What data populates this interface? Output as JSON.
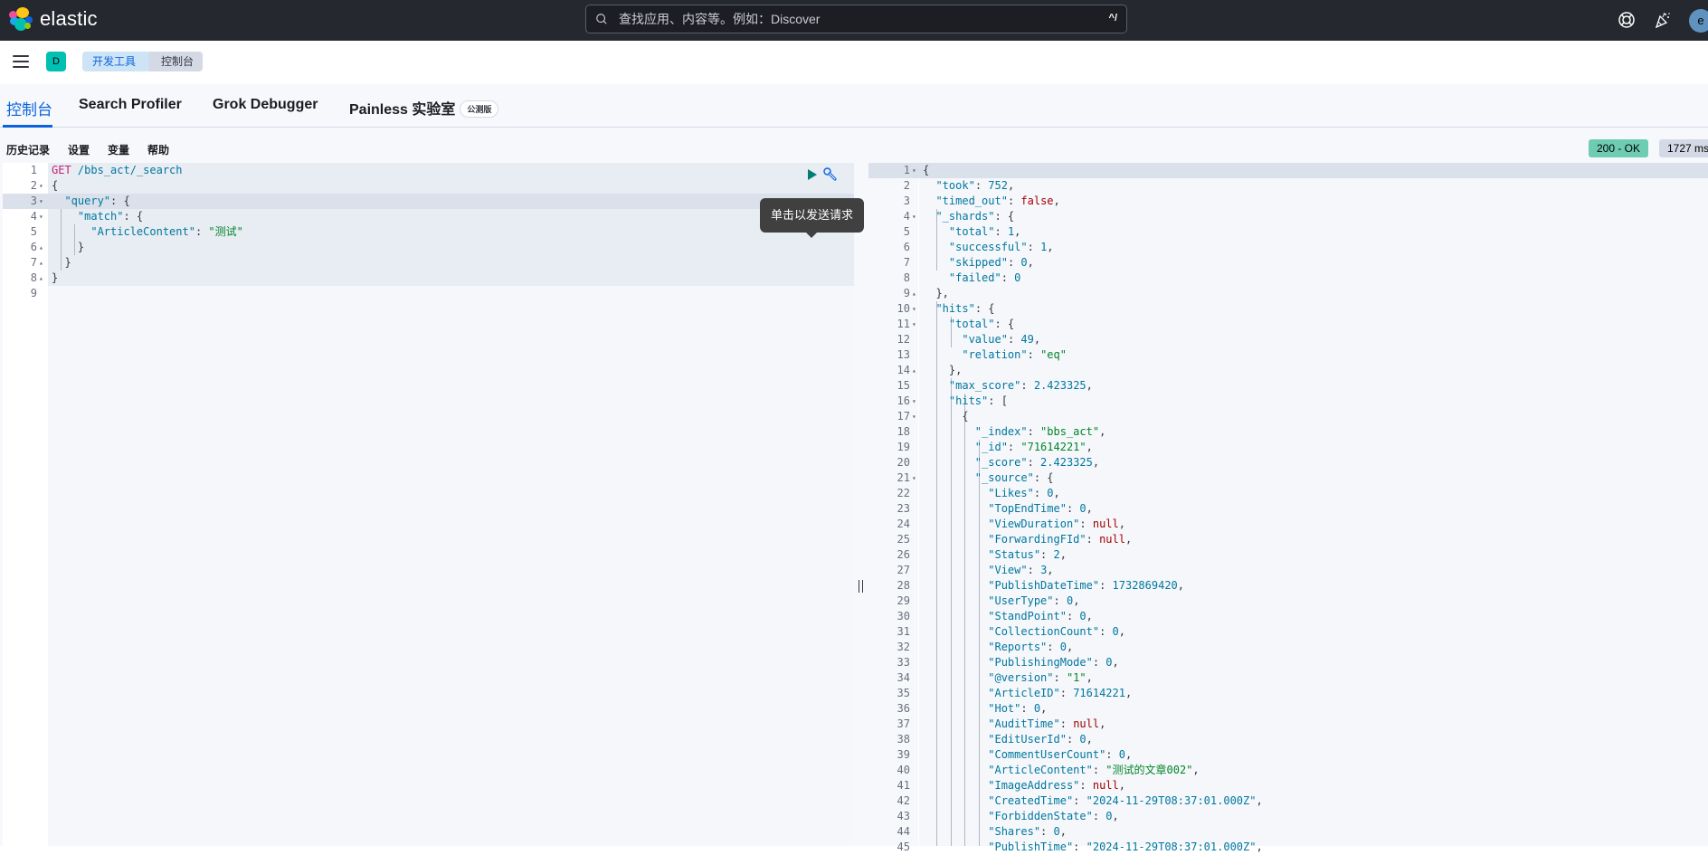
{
  "header": {
    "brand": "elastic",
    "search_placeholder": "查找应用、内容等。例如：Discover",
    "search_shortcut": "^/",
    "avatar_letter": "e"
  },
  "breadcrumbs": {
    "space_letter": "D",
    "items": [
      "开发工具",
      "控制台"
    ]
  },
  "tabs": [
    {
      "label": "控制台",
      "active": true
    },
    {
      "label": "Search Profiler",
      "active": false
    },
    {
      "label": "Grok Debugger",
      "active": false
    },
    {
      "label": "Painless 实验室",
      "active": false,
      "badge": "公测版"
    }
  ],
  "toolbar": [
    "历史记录",
    "设置",
    "变量",
    "帮助"
  ],
  "tooltip": "单击以发送请求",
  "response_status": {
    "status": "200 - OK",
    "status_color": "#6dccb1",
    "time": "1727 ms"
  },
  "request_editor": {
    "lines": [
      {
        "n": "1",
        "fold": "",
        "tokens": [
          [
            "m",
            "GET "
          ],
          [
            "k",
            "/bbs_act/_search"
          ]
        ]
      },
      {
        "n": "2",
        "fold": "▾",
        "tokens": [
          [
            "p",
            "{"
          ]
        ]
      },
      {
        "n": "3",
        "fold": "▾",
        "tokens": [
          [
            "p",
            "  "
          ],
          [
            "k",
            "\"query\""
          ],
          [
            "p",
            ": {"
          ]
        ]
      },
      {
        "n": "4",
        "fold": "▾",
        "tokens": [
          [
            "p",
            "    "
          ],
          [
            "k",
            "\"match\""
          ],
          [
            "p",
            ": {"
          ]
        ]
      },
      {
        "n": "5",
        "fold": "",
        "tokens": [
          [
            "p",
            "      "
          ],
          [
            "k",
            "\"ArticleContent\""
          ],
          [
            "p",
            ": "
          ],
          [
            "s",
            "\"测试\""
          ]
        ]
      },
      {
        "n": "6",
        "fold": "▴",
        "tokens": [
          [
            "p",
            "    }"
          ]
        ]
      },
      {
        "n": "7",
        "fold": "▴",
        "tokens": [
          [
            "p",
            "  }"
          ]
        ]
      },
      {
        "n": "8",
        "fold": "▴",
        "tokens": [
          [
            "p",
            "}"
          ]
        ]
      },
      {
        "n": "9",
        "fold": "",
        "tokens": []
      }
    ]
  },
  "response_editor": {
    "lines": [
      {
        "n": "1",
        "fold": "▾",
        "tokens": [
          [
            "p",
            "{"
          ]
        ]
      },
      {
        "n": "2",
        "fold": "",
        "tokens": [
          [
            "p",
            "  "
          ],
          [
            "k",
            "\"took\""
          ],
          [
            "p",
            ": "
          ],
          [
            "n",
            "752"
          ],
          [
            "p",
            ","
          ]
        ]
      },
      {
        "n": "3",
        "fold": "",
        "tokens": [
          [
            "p",
            "  "
          ],
          [
            "k",
            "\"timed_out\""
          ],
          [
            "p",
            ": "
          ],
          [
            "b",
            "false"
          ],
          [
            "p",
            ","
          ]
        ]
      },
      {
        "n": "4",
        "fold": "▾",
        "tokens": [
          [
            "p",
            "  "
          ],
          [
            "k",
            "\"_shards\""
          ],
          [
            "p",
            ": {"
          ]
        ]
      },
      {
        "n": "5",
        "fold": "",
        "tokens": [
          [
            "p",
            "    "
          ],
          [
            "k",
            "\"total\""
          ],
          [
            "p",
            ": "
          ],
          [
            "n",
            "1"
          ],
          [
            "p",
            ","
          ]
        ]
      },
      {
        "n": "6",
        "fold": "",
        "tokens": [
          [
            "p",
            "    "
          ],
          [
            "k",
            "\"successful\""
          ],
          [
            "p",
            ": "
          ],
          [
            "n",
            "1"
          ],
          [
            "p",
            ","
          ]
        ]
      },
      {
        "n": "7",
        "fold": "",
        "tokens": [
          [
            "p",
            "    "
          ],
          [
            "k",
            "\"skipped\""
          ],
          [
            "p",
            ": "
          ],
          [
            "n",
            "0"
          ],
          [
            "p",
            ","
          ]
        ]
      },
      {
        "n": "8",
        "fold": "",
        "tokens": [
          [
            "p",
            "    "
          ],
          [
            "k",
            "\"failed\""
          ],
          [
            "p",
            ": "
          ],
          [
            "n",
            "0"
          ]
        ]
      },
      {
        "n": "9",
        "fold": "▴",
        "tokens": [
          [
            "p",
            "  },"
          ]
        ]
      },
      {
        "n": "10",
        "fold": "▾",
        "tokens": [
          [
            "p",
            "  "
          ],
          [
            "k",
            "\"hits\""
          ],
          [
            "p",
            ": {"
          ]
        ]
      },
      {
        "n": "11",
        "fold": "▾",
        "tokens": [
          [
            "p",
            "    "
          ],
          [
            "k",
            "\"total\""
          ],
          [
            "p",
            ": {"
          ]
        ]
      },
      {
        "n": "12",
        "fold": "",
        "tokens": [
          [
            "p",
            "      "
          ],
          [
            "k",
            "\"value\""
          ],
          [
            "p",
            ": "
          ],
          [
            "n",
            "49"
          ],
          [
            "p",
            ","
          ]
        ]
      },
      {
        "n": "13",
        "fold": "",
        "tokens": [
          [
            "p",
            "      "
          ],
          [
            "k",
            "\"relation\""
          ],
          [
            "p",
            ": "
          ],
          [
            "s",
            "\"eq\""
          ]
        ]
      },
      {
        "n": "14",
        "fold": "▴",
        "tokens": [
          [
            "p",
            "    },"
          ]
        ]
      },
      {
        "n": "15",
        "fold": "",
        "tokens": [
          [
            "p",
            "    "
          ],
          [
            "k",
            "\"max_score\""
          ],
          [
            "p",
            ": "
          ],
          [
            "n",
            "2.423325"
          ],
          [
            "p",
            ","
          ]
        ]
      },
      {
        "n": "16",
        "fold": "▾",
        "tokens": [
          [
            "p",
            "    "
          ],
          [
            "k",
            "\"hits\""
          ],
          [
            "p",
            ": ["
          ]
        ]
      },
      {
        "n": "17",
        "fold": "▾",
        "tokens": [
          [
            "p",
            "      {"
          ]
        ]
      },
      {
        "n": "18",
        "fold": "",
        "tokens": [
          [
            "p",
            "        "
          ],
          [
            "k",
            "\"_index\""
          ],
          [
            "p",
            ": "
          ],
          [
            "s",
            "\"bbs_act\""
          ],
          [
            "p",
            ","
          ]
        ]
      },
      {
        "n": "19",
        "fold": "",
        "tokens": [
          [
            "p",
            "        "
          ],
          [
            "k",
            "\"_id\""
          ],
          [
            "p",
            ": "
          ],
          [
            "s",
            "\"71614221\""
          ],
          [
            "p",
            ","
          ]
        ]
      },
      {
        "n": "20",
        "fold": "",
        "tokens": [
          [
            "p",
            "        "
          ],
          [
            "k",
            "\"_score\""
          ],
          [
            "p",
            ": "
          ],
          [
            "n",
            "2.423325"
          ],
          [
            "p",
            ","
          ]
        ]
      },
      {
        "n": "21",
        "fold": "▾",
        "tokens": [
          [
            "p",
            "        "
          ],
          [
            "k",
            "\"_source\""
          ],
          [
            "p",
            ": {"
          ]
        ]
      },
      {
        "n": "22",
        "fold": "",
        "tokens": [
          [
            "p",
            "          "
          ],
          [
            "k",
            "\"Likes\""
          ],
          [
            "p",
            ": "
          ],
          [
            "n",
            "0"
          ],
          [
            "p",
            ","
          ]
        ]
      },
      {
        "n": "23",
        "fold": "",
        "tokens": [
          [
            "p",
            "          "
          ],
          [
            "k",
            "\"TopEndTime\""
          ],
          [
            "p",
            ": "
          ],
          [
            "n",
            "0"
          ],
          [
            "p",
            ","
          ]
        ]
      },
      {
        "n": "24",
        "fold": "",
        "tokens": [
          [
            "p",
            "          "
          ],
          [
            "k",
            "\"ViewDuration\""
          ],
          [
            "p",
            ": "
          ],
          [
            "b",
            "null"
          ],
          [
            "p",
            ","
          ]
        ]
      },
      {
        "n": "25",
        "fold": "",
        "tokens": [
          [
            "p",
            "          "
          ],
          [
            "k",
            "\"ForwardingFId\""
          ],
          [
            "p",
            ": "
          ],
          [
            "b",
            "null"
          ],
          [
            "p",
            ","
          ]
        ]
      },
      {
        "n": "26",
        "fold": "",
        "tokens": [
          [
            "p",
            "          "
          ],
          [
            "k",
            "\"Status\""
          ],
          [
            "p",
            ": "
          ],
          [
            "n",
            "2"
          ],
          [
            "p",
            ","
          ]
        ]
      },
      {
        "n": "27",
        "fold": "",
        "tokens": [
          [
            "p",
            "          "
          ],
          [
            "k",
            "\"View\""
          ],
          [
            "p",
            ": "
          ],
          [
            "n",
            "3"
          ],
          [
            "p",
            ","
          ]
        ]
      },
      {
        "n": "28",
        "fold": "",
        "tokens": [
          [
            "p",
            "          "
          ],
          [
            "k",
            "\"PublishDateTime\""
          ],
          [
            "p",
            ": "
          ],
          [
            "n",
            "1732869420"
          ],
          [
            "p",
            ","
          ]
        ]
      },
      {
        "n": "29",
        "fold": "",
        "tokens": [
          [
            "p",
            "          "
          ],
          [
            "k",
            "\"UserType\""
          ],
          [
            "p",
            ": "
          ],
          [
            "n",
            "0"
          ],
          [
            "p",
            ","
          ]
        ]
      },
      {
        "n": "30",
        "fold": "",
        "tokens": [
          [
            "p",
            "          "
          ],
          [
            "k",
            "\"StandPoint\""
          ],
          [
            "p",
            ": "
          ],
          [
            "n",
            "0"
          ],
          [
            "p",
            ","
          ]
        ]
      },
      {
        "n": "31",
        "fold": "",
        "tokens": [
          [
            "p",
            "          "
          ],
          [
            "k",
            "\"CollectionCount\""
          ],
          [
            "p",
            ": "
          ],
          [
            "n",
            "0"
          ],
          [
            "p",
            ","
          ]
        ]
      },
      {
        "n": "32",
        "fold": "",
        "tokens": [
          [
            "p",
            "          "
          ],
          [
            "k",
            "\"Reports\""
          ],
          [
            "p",
            ": "
          ],
          [
            "n",
            "0"
          ],
          [
            "p",
            ","
          ]
        ]
      },
      {
        "n": "33",
        "fold": "",
        "tokens": [
          [
            "p",
            "          "
          ],
          [
            "k",
            "\"PublishingMode\""
          ],
          [
            "p",
            ": "
          ],
          [
            "n",
            "0"
          ],
          [
            "p",
            ","
          ]
        ]
      },
      {
        "n": "34",
        "fold": "",
        "tokens": [
          [
            "p",
            "          "
          ],
          [
            "k",
            "\"@version\""
          ],
          [
            "p",
            ": "
          ],
          [
            "s",
            "\"1\""
          ],
          [
            "p",
            ","
          ]
        ]
      },
      {
        "n": "35",
        "fold": "",
        "tokens": [
          [
            "p",
            "          "
          ],
          [
            "k",
            "\"ArticleID\""
          ],
          [
            "p",
            ": "
          ],
          [
            "n",
            "71614221"
          ],
          [
            "p",
            ","
          ]
        ]
      },
      {
        "n": "36",
        "fold": "",
        "tokens": [
          [
            "p",
            "          "
          ],
          [
            "k",
            "\"Hot\""
          ],
          [
            "p",
            ": "
          ],
          [
            "n",
            "0"
          ],
          [
            "p",
            ","
          ]
        ]
      },
      {
        "n": "37",
        "fold": "",
        "tokens": [
          [
            "p",
            "          "
          ],
          [
            "k",
            "\"AuditTime\""
          ],
          [
            "p",
            ": "
          ],
          [
            "b",
            "null"
          ],
          [
            "p",
            ","
          ]
        ]
      },
      {
        "n": "38",
        "fold": "",
        "tokens": [
          [
            "p",
            "          "
          ],
          [
            "k",
            "\"EditUserId\""
          ],
          [
            "p",
            ": "
          ],
          [
            "n",
            "0"
          ],
          [
            "p",
            ","
          ]
        ]
      },
      {
        "n": "39",
        "fold": "",
        "tokens": [
          [
            "p",
            "          "
          ],
          [
            "k",
            "\"CommentUserCount\""
          ],
          [
            "p",
            ": "
          ],
          [
            "n",
            "0"
          ],
          [
            "p",
            ","
          ]
        ]
      },
      {
        "n": "40",
        "fold": "",
        "tokens": [
          [
            "p",
            "          "
          ],
          [
            "k",
            "\"ArticleContent\""
          ],
          [
            "p",
            ": "
          ],
          [
            "s",
            "\"测试的文章002\""
          ],
          [
            "p",
            ","
          ]
        ]
      },
      {
        "n": "41",
        "fold": "",
        "tokens": [
          [
            "p",
            "          "
          ],
          [
            "k",
            "\"ImageAddress\""
          ],
          [
            "p",
            ": "
          ],
          [
            "b",
            "null"
          ],
          [
            "p",
            ","
          ]
        ]
      },
      {
        "n": "42",
        "fold": "",
        "tokens": [
          [
            "p",
            "          "
          ],
          [
            "k",
            "\"CreatedTime\""
          ],
          [
            "p",
            ": "
          ],
          [
            "k",
            "\"2024-11-29T08:37:01.000Z\""
          ],
          [
            "p",
            ","
          ]
        ]
      },
      {
        "n": "43",
        "fold": "",
        "tokens": [
          [
            "p",
            "          "
          ],
          [
            "k",
            "\"ForbiddenState\""
          ],
          [
            "p",
            ": "
          ],
          [
            "n",
            "0"
          ],
          [
            "p",
            ","
          ]
        ]
      },
      {
        "n": "44",
        "fold": "",
        "tokens": [
          [
            "p",
            "          "
          ],
          [
            "k",
            "\"Shares\""
          ],
          [
            "p",
            ": "
          ],
          [
            "n",
            "0"
          ],
          [
            "p",
            ","
          ]
        ]
      },
      {
        "n": "45",
        "fold": "",
        "tokens": [
          [
            "p",
            "          "
          ],
          [
            "k",
            "\"PublishTime\""
          ],
          [
            "p",
            ": "
          ],
          [
            "k",
            "\"2024-11-29T08:37:01.000Z\""
          ],
          [
            "p",
            ","
          ]
        ]
      }
    ]
  }
}
